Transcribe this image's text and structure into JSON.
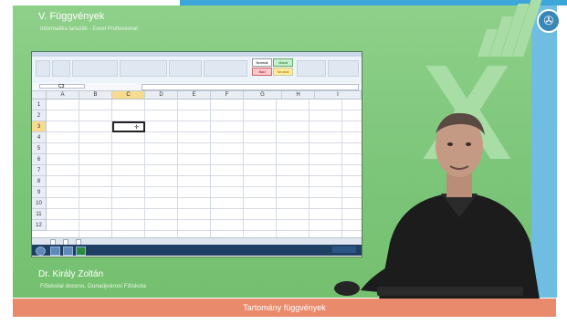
{
  "slide": {
    "chapter_title": "V. Függvények",
    "course_subtitle": "Informatika tanszék - Excel Professional",
    "presenter_name": "Dr. Király Zoltán",
    "presenter_role": "Főiskolai docens, Dunaújvárosi Főiskola",
    "topic_title": "Tartomány függvények"
  },
  "excel": {
    "name_box": "C3",
    "columns": [
      "A",
      "B",
      "C",
      "D",
      "E",
      "F",
      "G",
      "H",
      "I"
    ],
    "rows": [
      "1",
      "2",
      "3",
      "4",
      "5",
      "6",
      "7",
      "8",
      "9",
      "10",
      "11",
      "12"
    ],
    "selected_column": "C",
    "selected_row": "3",
    "styles": {
      "normal": "Normal",
      "bad": "Bad",
      "good": "Good",
      "neutral": "Neutral"
    }
  },
  "colors": {
    "slide_green": "#7cc67a",
    "accent_blue": "#3da6d8",
    "bottom_bar": "#ea8a6c"
  }
}
